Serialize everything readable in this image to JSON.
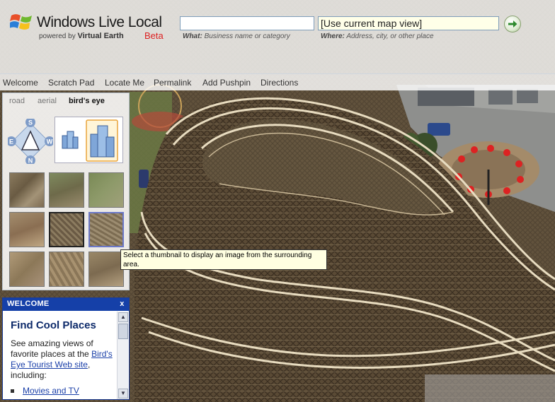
{
  "header": {
    "logo_text": "Windows Live Local",
    "powered_by": "powered by",
    "powered_brand": "Virtual Earth",
    "beta": "Beta",
    "what_value": "",
    "where_value": "[Use current map view]",
    "what_hint_label": "What:",
    "what_hint_text": "Business name or category",
    "where_hint_label": "Where:",
    "where_hint_text": "Address, city, or other place"
  },
  "nav": {
    "items": [
      "Welcome",
      "Scratch Pad",
      "Locate Me",
      "Permalink",
      "Add Pushpin",
      "Directions"
    ]
  },
  "panel": {
    "tabs": [
      "road",
      "aerial",
      "bird's eye"
    ],
    "active_tab": "bird's eye",
    "compass_letters": [
      "S",
      "E",
      "W",
      "N"
    ]
  },
  "tooltip": {
    "text": "Select a thumbnail to display an image from the surrounding area."
  },
  "welcome": {
    "header": "WELCOME",
    "close": "x",
    "title": "Find Cool Places",
    "text_before": "See amazing views of favorite places at the",
    "link": "Bird's Eye Tourist Web site",
    "text_after": ", including:",
    "list_item": "Movies and TV"
  },
  "colors": {
    "welcome_header": "#1540a8",
    "link": "#1a3fa8",
    "beta_red": "#dd2222"
  }
}
